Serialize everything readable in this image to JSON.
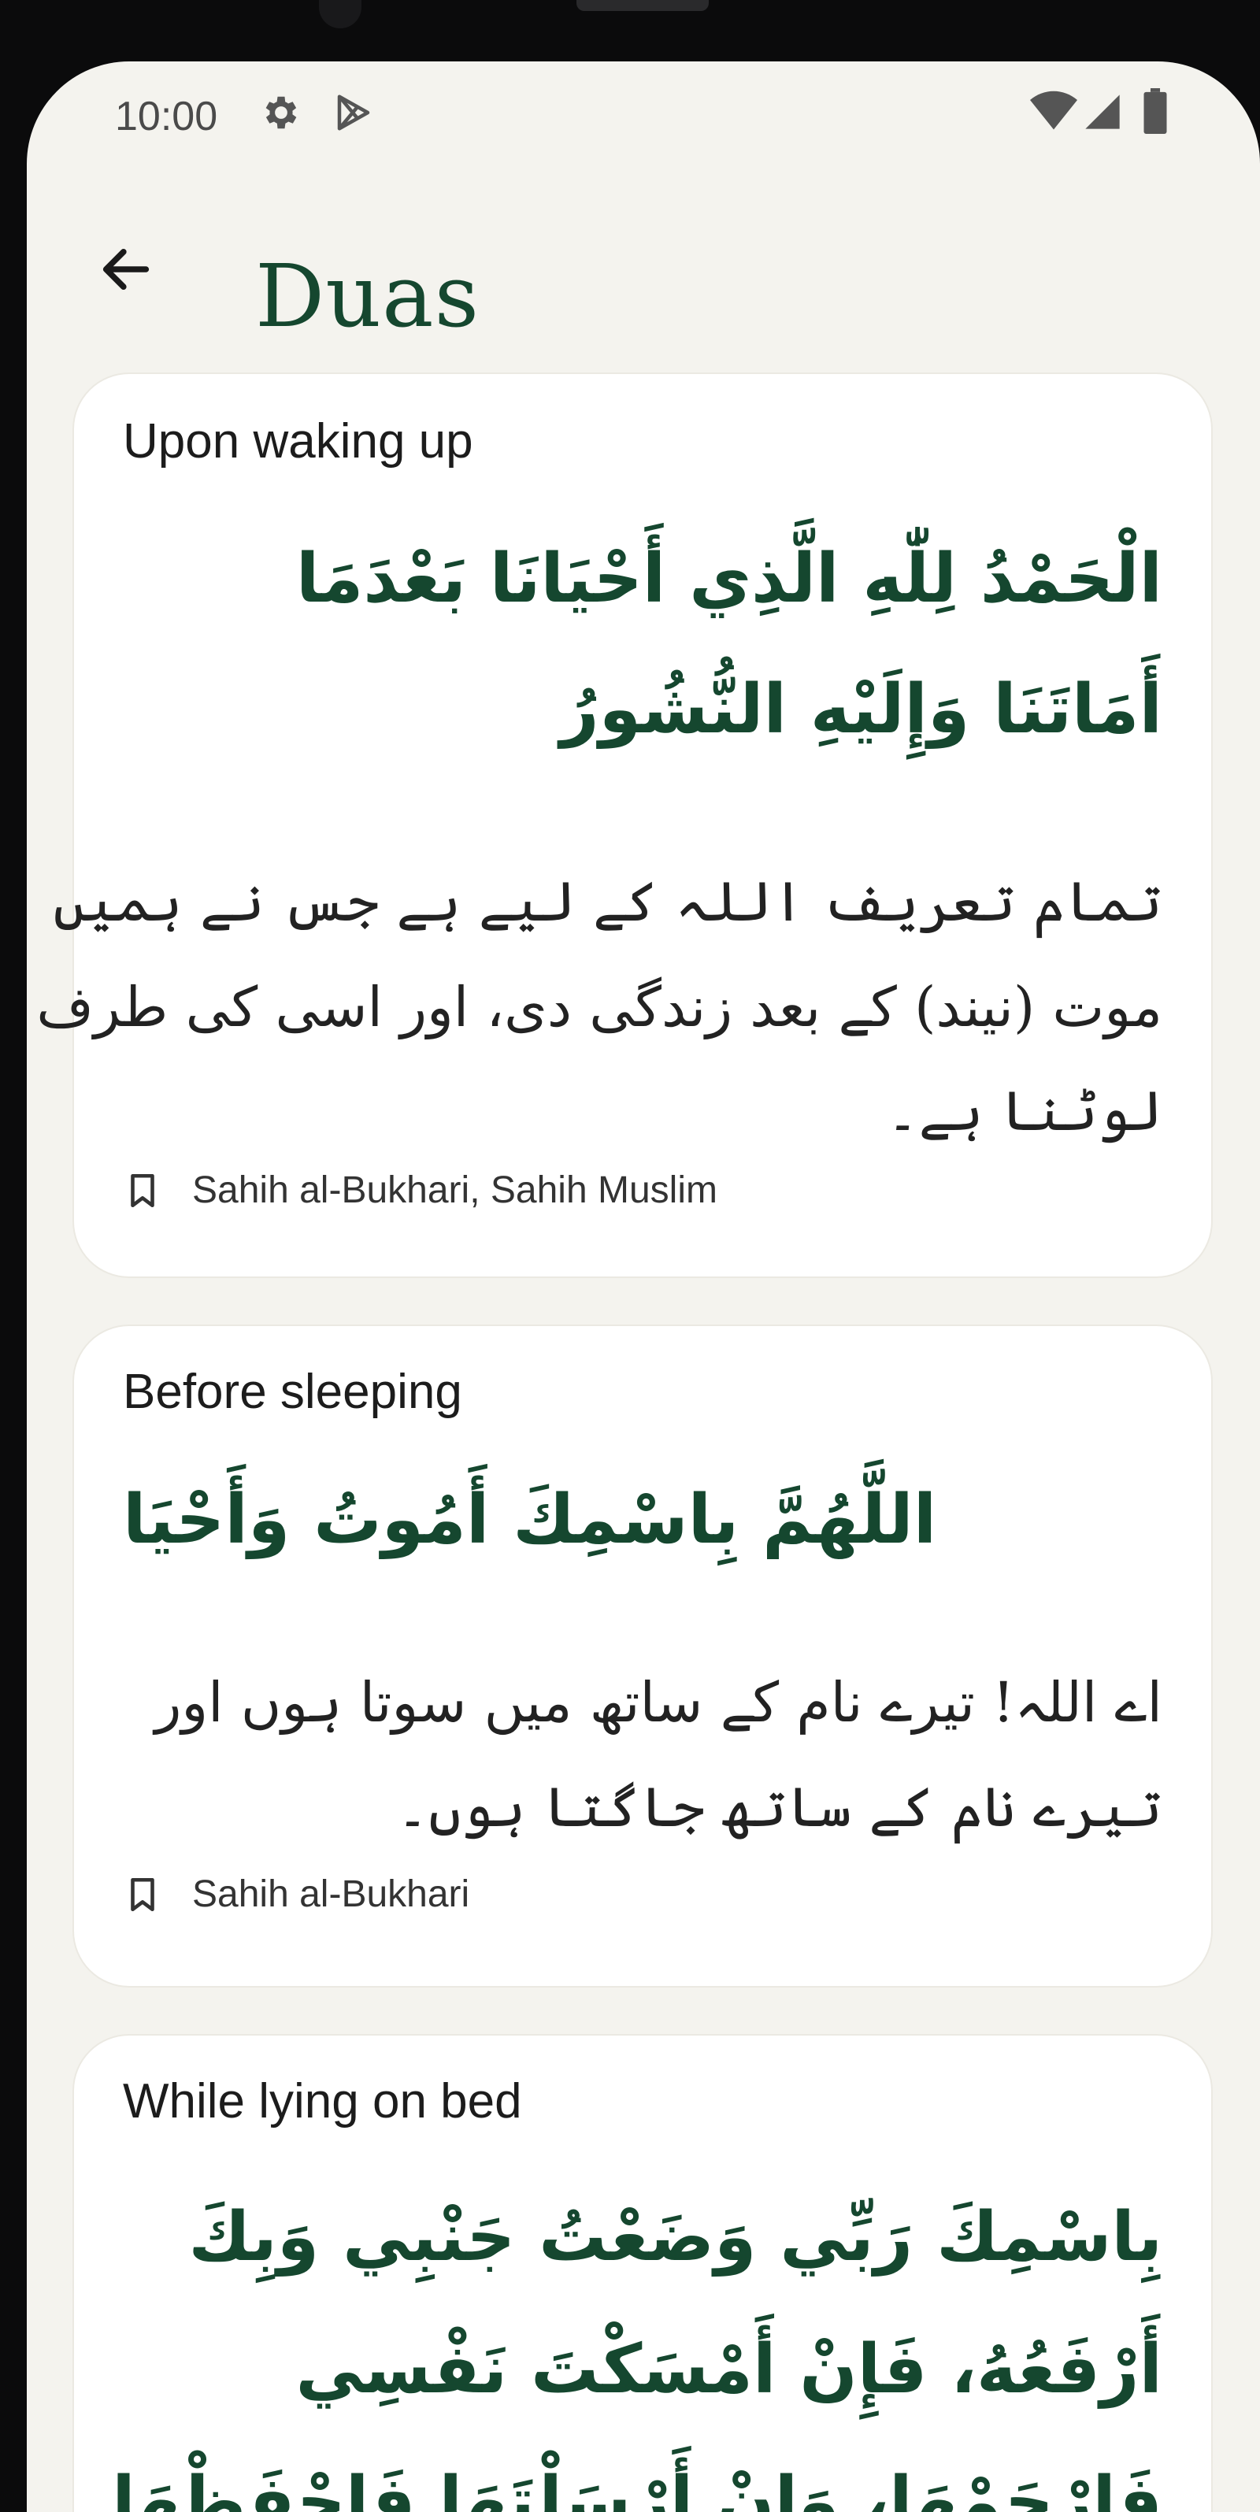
{
  "status_bar": {
    "time": "10:00",
    "left_icons": [
      "gear-icon",
      "play-store-icon"
    ],
    "right_icons": [
      "wifi-icon",
      "signal-icon",
      "battery-icon"
    ]
  },
  "top_bar": {
    "back_icon": "arrow-left-icon",
    "title": "Duas"
  },
  "colors": {
    "accent": "#15472f",
    "background": "#f4f3ee",
    "card": "#ffffff"
  },
  "duas": [
    {
      "title": "Upon waking up",
      "arabic_lines": [
        "الْحَمْدُ لِلّٰهِ الَّذِي أَحْيَانَا بَعْدَمَا",
        "أَمَاتَنَا وَإِلَيْهِ النُّشُورُ"
      ],
      "urdu_lines": [
        "تمام تعریف اللہ کے لیے ہے جس نے ہمیں",
        "موت (نیند) کے بعد زندگی دی، اور اسی کی طرف",
        "لوٹنا ہے۔"
      ],
      "source": "Sahih al-Bukhari, Sahih Muslim"
    },
    {
      "title": "Before sleeping",
      "arabic_lines": [
        "اللَّهُمَّ بِاسْمِكَ أَمُوتُ وَأَحْيَا"
      ],
      "urdu_lines": [
        "اے اللہ! تیرے نام کے ساتھ میں سوتا ہوں اور",
        "تیرے نام کے ساتھ جاگتا ہوں۔"
      ],
      "source": "Sahih al-Bukhari"
    },
    {
      "title": "While lying on bed",
      "arabic_lines": [
        "بِاسْمِكَ رَبِّي وَضَعْتُ جَنْبِي وَبِكَ",
        "أَرْفَعُهُ، فَإِنْ أَمْسَكْتَ نَفْسِي",
        "فَارْحَمْهَا، وَإِنْ أَرْسَلْتَهَا فَاحْفَظْهَا"
      ]
    }
  ]
}
